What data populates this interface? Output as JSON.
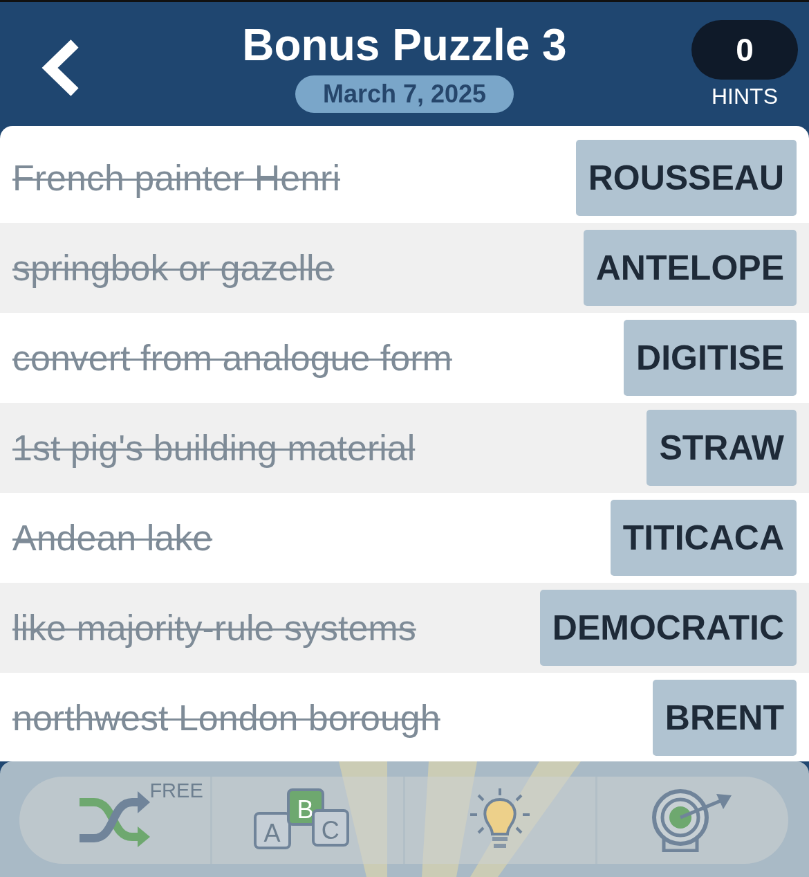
{
  "header": {
    "title": "Bonus Puzzle 3",
    "date": "March 7, 2025",
    "hints": {
      "count": "0",
      "label": "HINTS"
    }
  },
  "clues": [
    {
      "clue": "French painter Henri",
      "answer": "ROUSSEAU",
      "solved": true
    },
    {
      "clue": "springbok or gazelle",
      "answer": "ANTELOPE",
      "solved": true
    },
    {
      "clue": "convert from analogue form",
      "answer": "DIGITISE",
      "solved": true
    },
    {
      "clue": "1st pig's building material",
      "answer": "STRAW",
      "solved": true
    },
    {
      "clue": "Andean lake",
      "answer": "TITICACA",
      "solved": true
    },
    {
      "clue": "like majority-rule systems",
      "answer": "DEMOCRATIC",
      "solved": true
    },
    {
      "clue": "northwest London borough",
      "answer": "BRENT",
      "solved": true
    }
  ],
  "toolbar": [
    {
      "kind": "shuffle",
      "badge": "FREE"
    },
    {
      "kind": "letters",
      "letters": [
        "A",
        "B",
        "C"
      ]
    },
    {
      "kind": "hint"
    },
    {
      "kind": "target"
    }
  ]
}
